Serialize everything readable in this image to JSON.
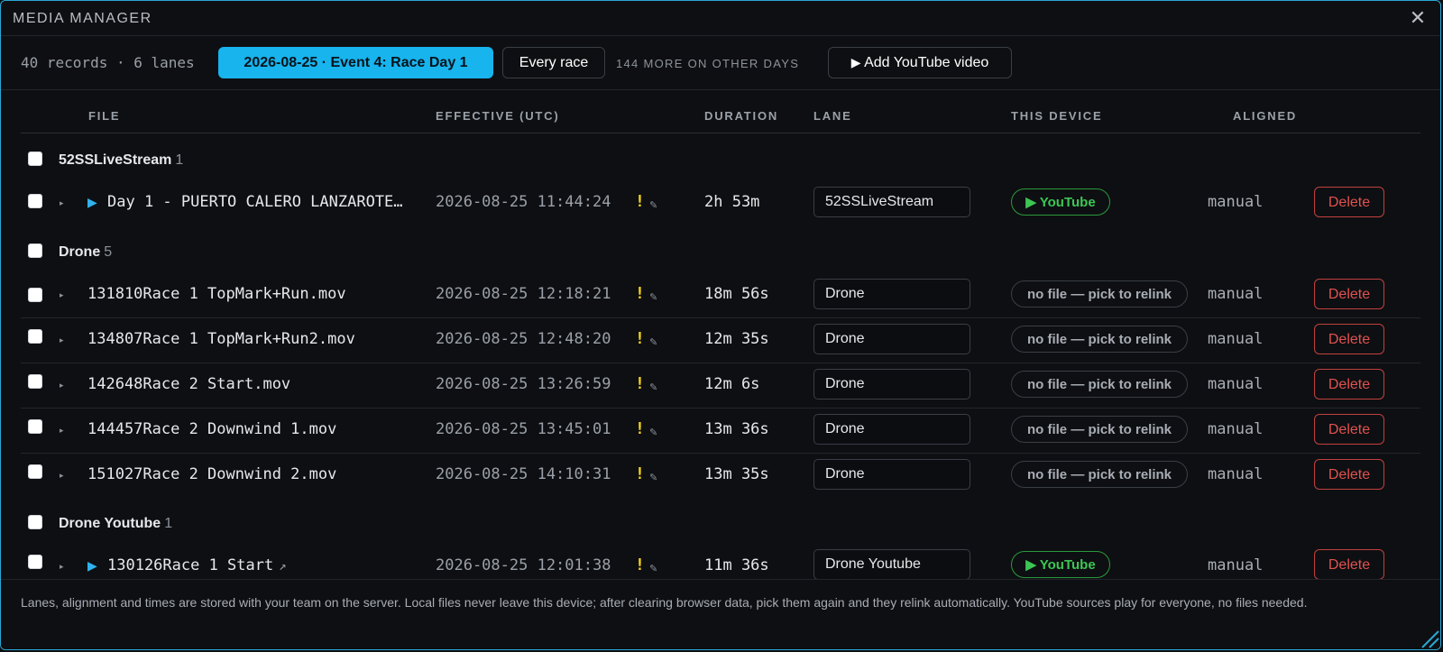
{
  "window": {
    "title": "MEDIA MANAGER",
    "close_icon": "close-icon",
    "accent": "#17b4ee"
  },
  "toolbar": {
    "counts": "40 records · 6 lanes",
    "active_filter": "2026-08-25 · Event 4: Race Day 1",
    "every_race": "Every race",
    "more_label": "144 MORE ON OTHER DAYS",
    "add_youtube": "Add YouTube video"
  },
  "columns": {
    "file": "FILE",
    "effective": "EFFECTIVE (UTC)",
    "duration": "DURATION",
    "lane": "LANE",
    "device": "THIS DEVICE",
    "aligned": "ALIGNED"
  },
  "groups": [
    {
      "name": "52SSLiveStream",
      "count": "1",
      "rows": [
        {
          "file": "Day 1 - PUERTO CALERO LANZAROTE…",
          "youtube": true,
          "effective": "2026-08-25 11:44:24",
          "warn": "!",
          "duration": "2h 53m",
          "lane": "52SSLiveStream",
          "device": "YouTube",
          "aligned": "manual",
          "delete": "Delete"
        }
      ]
    },
    {
      "name": "Drone",
      "count": "5",
      "rows": [
        {
          "file": "131810Race 1 TopMark+Run.mov",
          "effective": "2026-08-25 12:18:21",
          "warn": "!",
          "duration": "18m 56s",
          "lane": "Drone",
          "device": "no file — pick to relink",
          "aligned": "manual",
          "delete": "Delete"
        },
        {
          "file": "134807Race 1 TopMark+Run2.mov",
          "effective": "2026-08-25 12:48:20",
          "warn": "!",
          "duration": "12m 35s",
          "lane": "Drone",
          "device": "no file — pick to relink",
          "aligned": "manual",
          "delete": "Delete"
        },
        {
          "file": "142648Race 2 Start.mov",
          "effective": "2026-08-25 13:26:59",
          "warn": "!",
          "duration": "12m 6s",
          "lane": "Drone",
          "device": "no file — pick to relink",
          "aligned": "manual",
          "delete": "Delete"
        },
        {
          "file": "144457Race 2 Downwind 1.mov",
          "effective": "2026-08-25 13:45:01",
          "warn": "!",
          "duration": "13m 36s",
          "lane": "Drone",
          "device": "no file — pick to relink",
          "aligned": "manual",
          "delete": "Delete"
        },
        {
          "file": "151027Race 2 Downwind 2.mov",
          "effective": "2026-08-25 14:10:31",
          "warn": "!",
          "duration": "13m 35s",
          "lane": "Drone",
          "device": "no file — pick to relink",
          "aligned": "manual",
          "delete": "Delete"
        }
      ]
    },
    {
      "name": "Drone Youtube",
      "count": "1",
      "rows": [
        {
          "file": "130126Race 1 Start",
          "youtube": true,
          "effective": "2026-08-25 12:01:38",
          "warn": "!",
          "duration": "11m 36s",
          "lane": "Drone Youtube",
          "device": "YouTube",
          "aligned": "manual",
          "delete": "Delete"
        }
      ]
    }
  ],
  "footer": {
    "text": "Lanes, alignment and times are stored with your team on the server. Local files never leave this device; after clearing browser data, pick them again and they relink automatically. YouTube sources play for everyone, no files needed."
  },
  "icons": {
    "play": "play-icon",
    "expand": "expand-caret-icon",
    "edit": "pencil-icon",
    "external": "external-link-icon",
    "resize": "resize-handle-icon"
  }
}
